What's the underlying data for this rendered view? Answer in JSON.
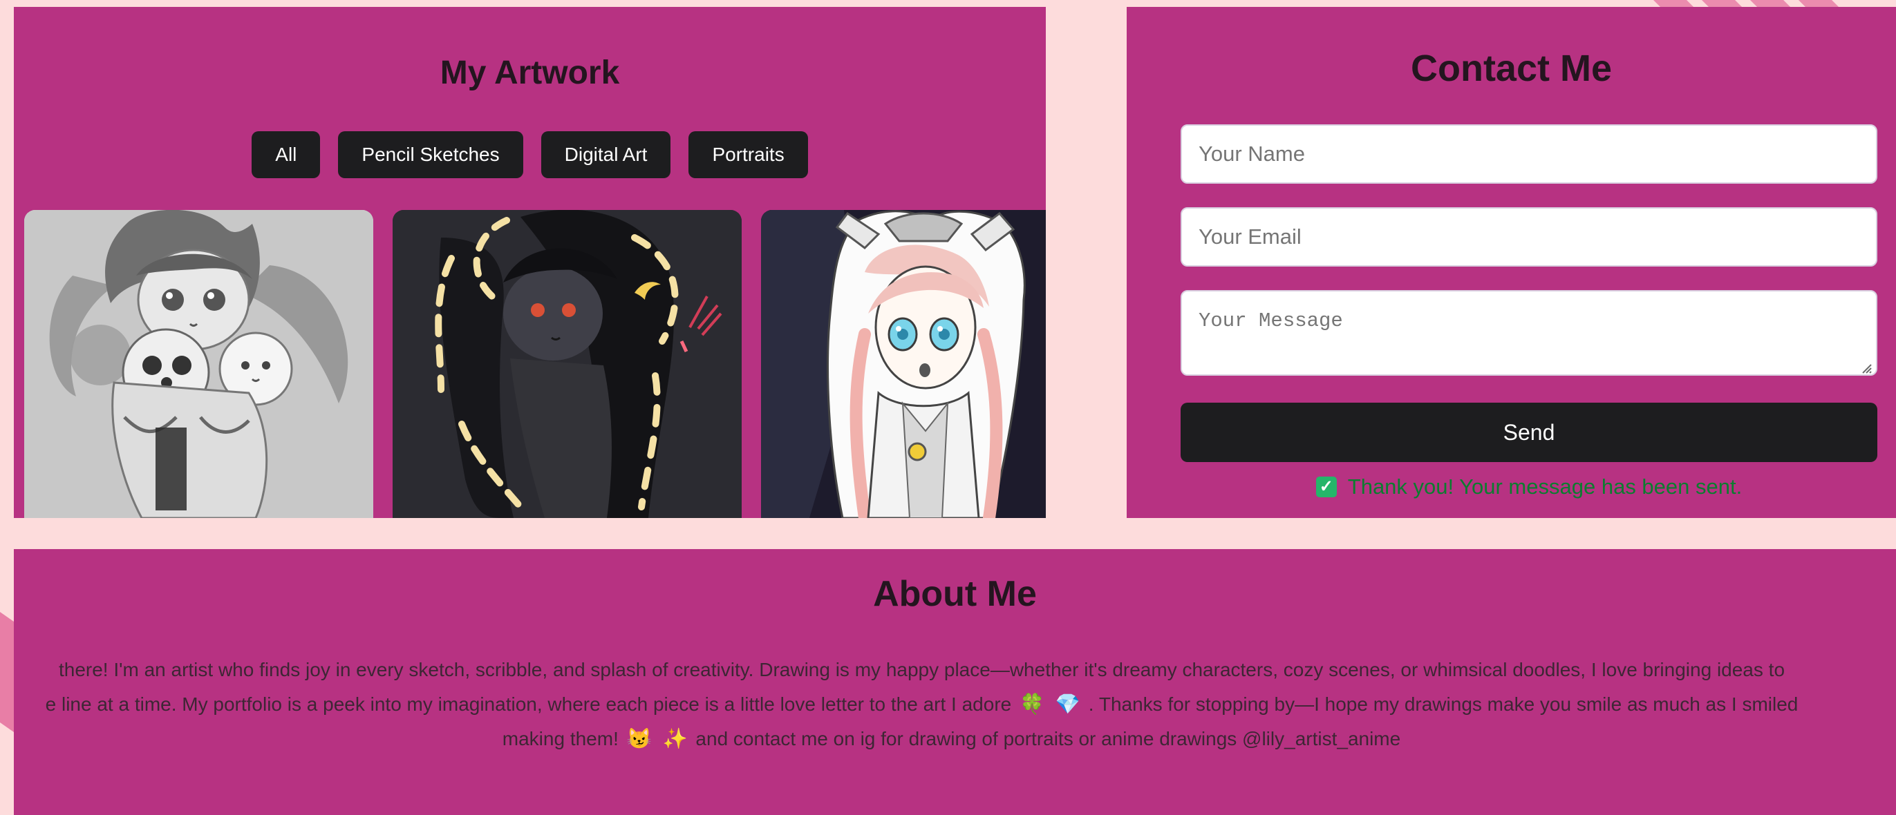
{
  "artwork": {
    "title": "My Artwork",
    "filters": [
      "All",
      "Pencil Sketches",
      "Digital Art",
      "Portraits"
    ]
  },
  "contact": {
    "title": "Contact Me",
    "name_placeholder": "Your Name",
    "email_placeholder": "Your Email",
    "message_placeholder": "Your Message",
    "send_label": "Send",
    "success_message": "Thank you! Your message has been sent."
  },
  "about": {
    "title": "About Me",
    "lines": [
      "there! I'm an artist who finds joy in every sketch, scribble, and splash of creativity. Drawing is my happy place—whether it's dreamy characters, cozy scenes, or whimsical doodles, I love bringing ideas to",
      "e line at a time. My portfolio is a peek into my imagination, where each piece is a little love letter to the art I adore",
      ". Thanks for stopping by—I hope my drawings make you smile as much as I smiled",
      "making them!",
      "and contact me on ig for drawing of portraits or anime drawings @lily_artist_anime"
    ],
    "emoji": {
      "clover": "🍀",
      "gem": "💎",
      "cat": "😼",
      "sparkles": "✨"
    }
  },
  "colors": {
    "page_background": "#fddcdc",
    "panel_background": "#b73282",
    "button_background": "#1d1d1f",
    "success_text": "#0b7d2f"
  },
  "icons": {
    "success": "check-box-icon",
    "resize": "resize-handle-icon"
  }
}
